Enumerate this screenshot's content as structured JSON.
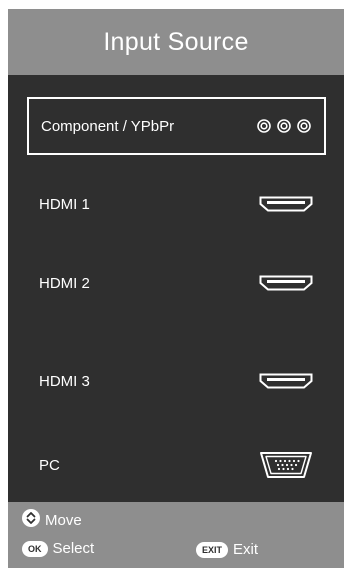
{
  "header": {
    "title": "Input Source"
  },
  "sources": [
    {
      "label": "Component / YPbPr",
      "icon": "component-rca-icon",
      "selected": true
    },
    {
      "label": "HDMI 1",
      "icon": "hdmi-port-icon",
      "selected": false
    },
    {
      "label": "HDMI 2",
      "icon": "hdmi-port-icon",
      "selected": false
    },
    {
      "label": "HDMI 3",
      "icon": "hdmi-port-icon",
      "selected": false
    },
    {
      "label": "PC",
      "icon": "vga-port-icon",
      "selected": false
    }
  ],
  "footer": {
    "move": {
      "label": "Move",
      "icon": "up-down-arrows-icon"
    },
    "select": {
      "key": "OK",
      "label": "Select"
    },
    "exit": {
      "key": "EXIT",
      "label": "Exit"
    }
  },
  "colors": {
    "panel": "#2f2f2f",
    "bars": "#8e8e8e",
    "text": "#ffffff"
  }
}
